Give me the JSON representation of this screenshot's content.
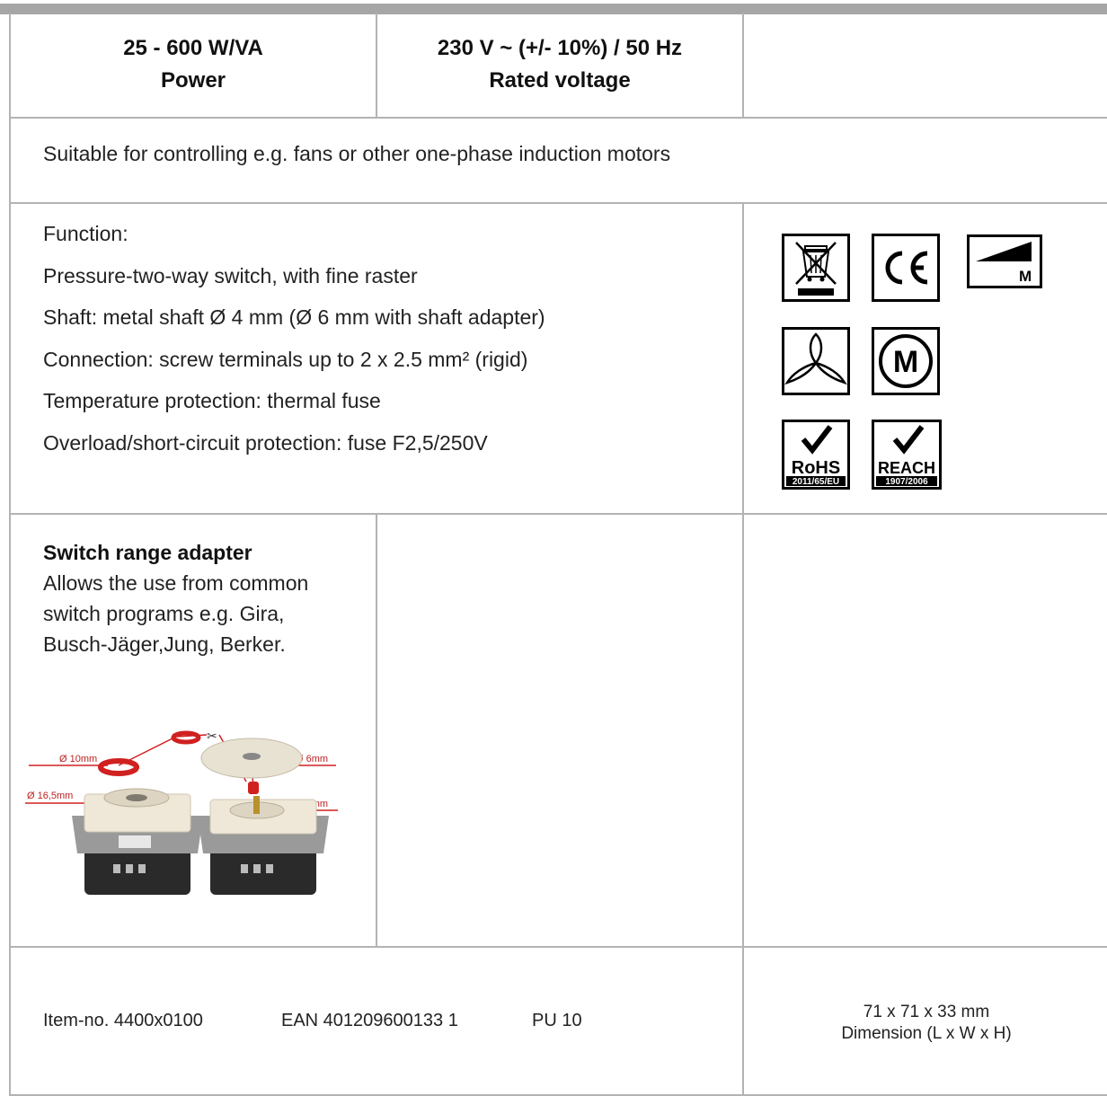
{
  "specs": {
    "power_value": "25 - 600 W/VA",
    "power_label": "Power",
    "voltage_value": "230 V ~ (+/- 10%)  / 50 Hz",
    "voltage_label": "Rated voltage"
  },
  "description": "Suitable for controlling e.g. fans or other one-phase induction motors",
  "function": {
    "heading": "Function:",
    "lines": [
      "Pressure-two-way switch, with fine raster",
      "Shaft: metal shaft Ø 4 mm (Ø 6 mm with shaft adapter)",
      "Connection: screw terminals up to 2 x 2.5 mm² (rigid)",
      "Temperature protection: thermal fuse",
      "Overload/short-circuit protection: fuse F2,5/250V"
    ]
  },
  "certifications": {
    "icons": [
      "weee-crossed-bin-icon",
      "ce-mark-icon",
      "motor-ramp-icon",
      "fan-icon",
      "motor-icon",
      "rohs-icon",
      "reach-icon"
    ],
    "ramp_label": "M",
    "motor_label": "M",
    "rohs_label": "RoHS",
    "rohs_sub": "2011/65/EU",
    "reach_label": "REACH",
    "reach_sub": "1907/2006"
  },
  "adapter": {
    "title": "Switch range adapter",
    "description": "Allows the use from common\nswitch programs  e.g. Gira,\nBusch-Jäger,Jung, Berker.",
    "photo_labels": {
      "d10": "Ø 10mm",
      "d16": "Ø 16,5mm",
      "d6": "Ø 6mm",
      "d4": "Ø 4mm"
    }
  },
  "footer": {
    "item_no": "Item-no. 4400x0100",
    "ean": "EAN 401209600133 1",
    "pu": "PU 10",
    "dimension_value": "71 x 71 x 33 mm",
    "dimension_label": "Dimension (L x W x H)"
  },
  "colors": {
    "grid": "#b3b3b3",
    "top_bar": "#a6a6a6",
    "accent_red": "#d02020"
  }
}
